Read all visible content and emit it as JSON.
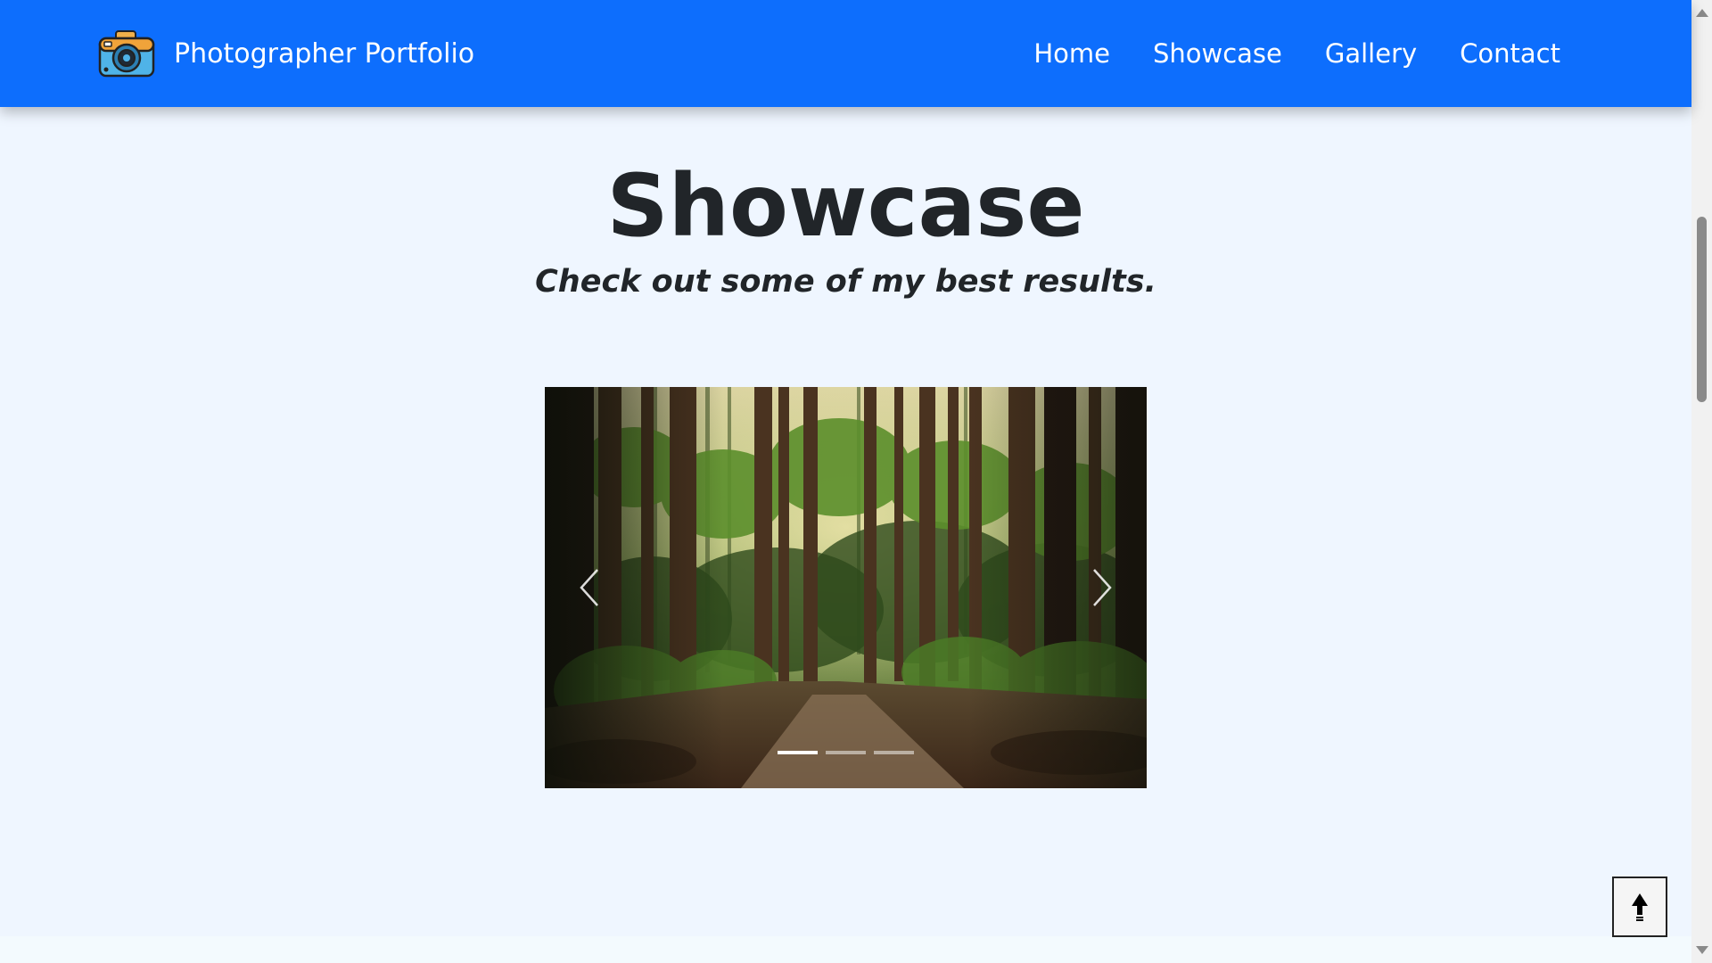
{
  "navbar": {
    "brand": "Photographer Portfolio",
    "links": [
      {
        "label": "Home"
      },
      {
        "label": "Showcase"
      },
      {
        "label": "Gallery"
      },
      {
        "label": "Contact"
      }
    ]
  },
  "hero": {
    "title": "Showcase",
    "subtitle": "Check out some of my best results."
  },
  "carousel": {
    "slide_count": 3,
    "active_slide": 1
  },
  "colors": {
    "navbar": "#0d6efd",
    "background": "#eff6ff",
    "text": "#212529"
  },
  "icons": {
    "logo": "camera-icon",
    "prev": "chevron-left-icon",
    "next": "chevron-right-icon",
    "back_to_top": "arrow-up-icon"
  }
}
